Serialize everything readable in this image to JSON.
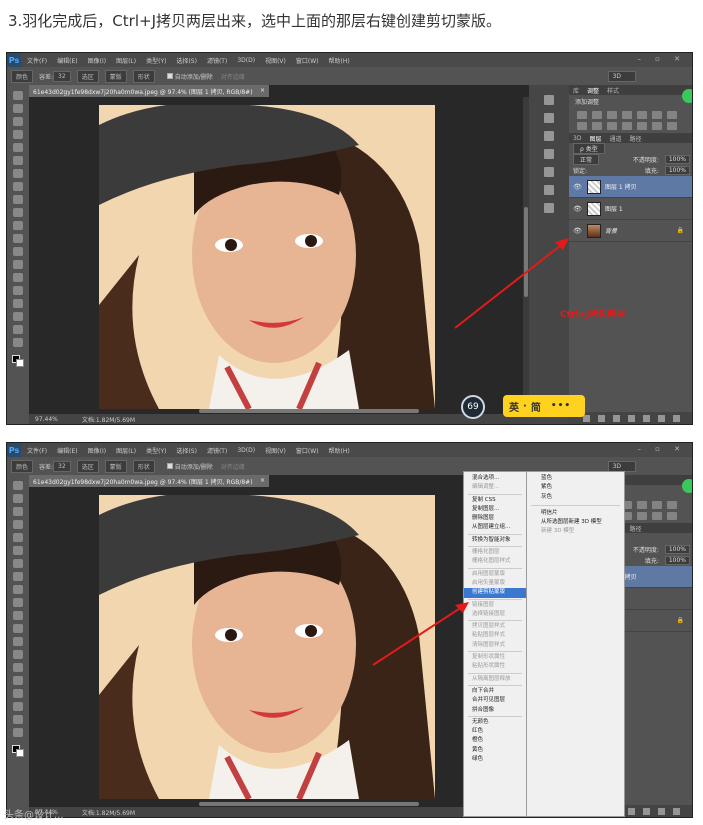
{
  "caption": "3.羽化完成后，Ctrl+J拷贝两层出来，选中上面的那层右键创建剪切蒙版。",
  "app": {
    "logo": "Ps",
    "menu": [
      "文件(F)",
      "编辑(E)",
      "图像(I)",
      "图层(L)",
      "类型(Y)",
      "选择(S)",
      "滤镜(T)",
      "3D(D)",
      "视图(V)",
      "窗口(W)",
      "帮助(H)"
    ],
    "window_controls": "– ▫ ✕"
  },
  "options_bar": {
    "mode": "颜色",
    "tolerance_label": "容差:",
    "tolerance_value": "32",
    "btn_a": "选区",
    "btn_b": "蒙版",
    "btn_c": "形状",
    "auto_add": "自动添加/删除",
    "align_edges": "对齐边缘",
    "threed": "3D"
  },
  "document": {
    "tab_title": "61e43d02gy1fe98dxw7j20ha0m0wa.jpeg @ 97.4% (图层 1 拷贝, RGB/8#)",
    "tab_close": "×",
    "zoom": "97.44%",
    "doc_info": "文档:1.82M/5.69M"
  },
  "layers_panel": {
    "tabs": [
      "库",
      "调整",
      "样式"
    ],
    "adjust_title": "添加调整",
    "layer_tabs": [
      "3D",
      "图层",
      "通道",
      "路径"
    ],
    "kind_label": "ρ 类型",
    "blend_mode": "正常",
    "opacity_label": "不透明度:",
    "opacity_value": "100%",
    "lock_label": "锁定:",
    "fill_label": "填充:",
    "fill_value": "100%",
    "layers": [
      {
        "name": "图层 1 拷贝",
        "active": true
      },
      {
        "name": "图层 1",
        "active": false
      },
      {
        "name": "背景",
        "active": false
      }
    ],
    "eye_icon": "👁",
    "lock_icon": "🔒"
  },
  "annotation": {
    "text": "Ctrl+J拷贝两层",
    "color": "#e21a1a"
  },
  "overlay": {
    "timer": "69",
    "ime_mode": "英",
    "ime_sep": "·",
    "ime_simplified": "简",
    "ime_dots": "•••"
  },
  "context_menu": {
    "items": [
      {
        "label": "混合选项...",
        "state": "normal"
      },
      {
        "label": "编辑调整...",
        "state": "disabled"
      },
      {
        "sep": true
      },
      {
        "label": "复制 CSS",
        "state": "normal"
      },
      {
        "label": "复制图层...",
        "state": "normal"
      },
      {
        "label": "删除图层",
        "state": "normal"
      },
      {
        "label": "从图层建立组...",
        "state": "normal"
      },
      {
        "sep": true
      },
      {
        "label": "转换为智能对象",
        "state": "normal"
      },
      {
        "sep": true
      },
      {
        "label": "栅格化图层",
        "state": "disabled"
      },
      {
        "label": "栅格化图层样式",
        "state": "disabled"
      },
      {
        "sep": true
      },
      {
        "label": "启用图层蒙版",
        "state": "disabled"
      },
      {
        "label": "启用矢量蒙版",
        "state": "disabled"
      },
      {
        "label": "创建剪贴蒙版",
        "state": "highlight"
      },
      {
        "sep": true
      },
      {
        "label": "链接图层",
        "state": "disabled"
      },
      {
        "label": "选择链接图层",
        "state": "disabled"
      },
      {
        "sep": true
      },
      {
        "label": "拷贝图层样式",
        "state": "disabled"
      },
      {
        "label": "粘贴图层样式",
        "state": "disabled"
      },
      {
        "label": "清除图层样式",
        "state": "disabled"
      },
      {
        "sep": true
      },
      {
        "label": "复制形状属性",
        "state": "disabled"
      },
      {
        "label": "粘贴形状属性",
        "state": "disabled"
      },
      {
        "sep": true
      },
      {
        "label": "从隔离图层释放",
        "state": "disabled"
      },
      {
        "sep": true
      },
      {
        "label": "向下合并",
        "state": "normal"
      },
      {
        "label": "合并可见图层",
        "state": "normal"
      },
      {
        "label": "拼合图像",
        "state": "normal"
      },
      {
        "sep": true
      },
      {
        "label": "无颜色",
        "state": "normal"
      },
      {
        "label": "红色",
        "state": "normal"
      },
      {
        "label": "橙色",
        "state": "normal"
      },
      {
        "label": "黄色",
        "state": "normal"
      },
      {
        "label": "绿色",
        "state": "normal"
      }
    ],
    "right_items": [
      {
        "label": "蓝色",
        "state": "normal"
      },
      {
        "label": "紫色",
        "state": "normal"
      },
      {
        "label": "灰色",
        "state": "normal"
      },
      {
        "sep": true
      },
      {
        "label": "明信片",
        "state": "normal"
      },
      {
        "label": "从所选图层新建 3D 模型",
        "state": "normal"
      },
      {
        "label": "新建 3D 模型",
        "state": "disabled"
      }
    ]
  },
  "watermark": "头条@设计..."
}
